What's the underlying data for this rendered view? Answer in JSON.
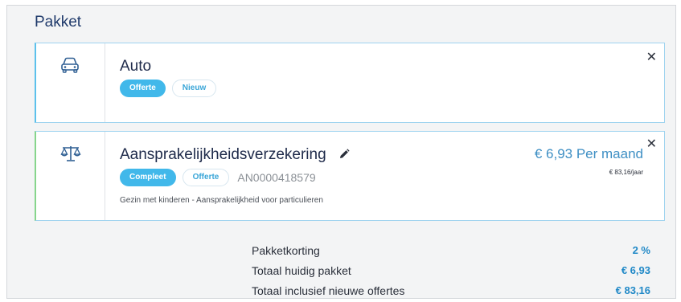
{
  "panel": {
    "title": "Pakket"
  },
  "cards": {
    "auto": {
      "icon": "car-icon",
      "title": "Auto",
      "badges": [
        "Offerte",
        "Nieuw"
      ]
    },
    "avp": {
      "icon": "scales-icon",
      "title": "Aansprakelijkheidsverzekering",
      "badges": [
        "Compleet",
        "Offerte"
      ],
      "policy_number": "AN0000418579",
      "description": "Gezin met kinderen - Aansprakelijkheid voor particulieren",
      "price_main": "€ 6,93 Per maand",
      "price_year": "€ 83,16/jaar"
    }
  },
  "summary": {
    "rows": [
      {
        "label": "Pakketkorting",
        "value": "2 %"
      },
      {
        "label": "Totaal huidig pakket",
        "value": "€ 6,93"
      },
      {
        "label": "Totaal inclusief nieuwe offertes",
        "value": "€ 83,16"
      }
    ]
  },
  "colors": {
    "accent": "#41b8ea",
    "price": "#3e8fc4",
    "summary_value": "#1f88c7",
    "complete_marker": "#86d58c"
  }
}
